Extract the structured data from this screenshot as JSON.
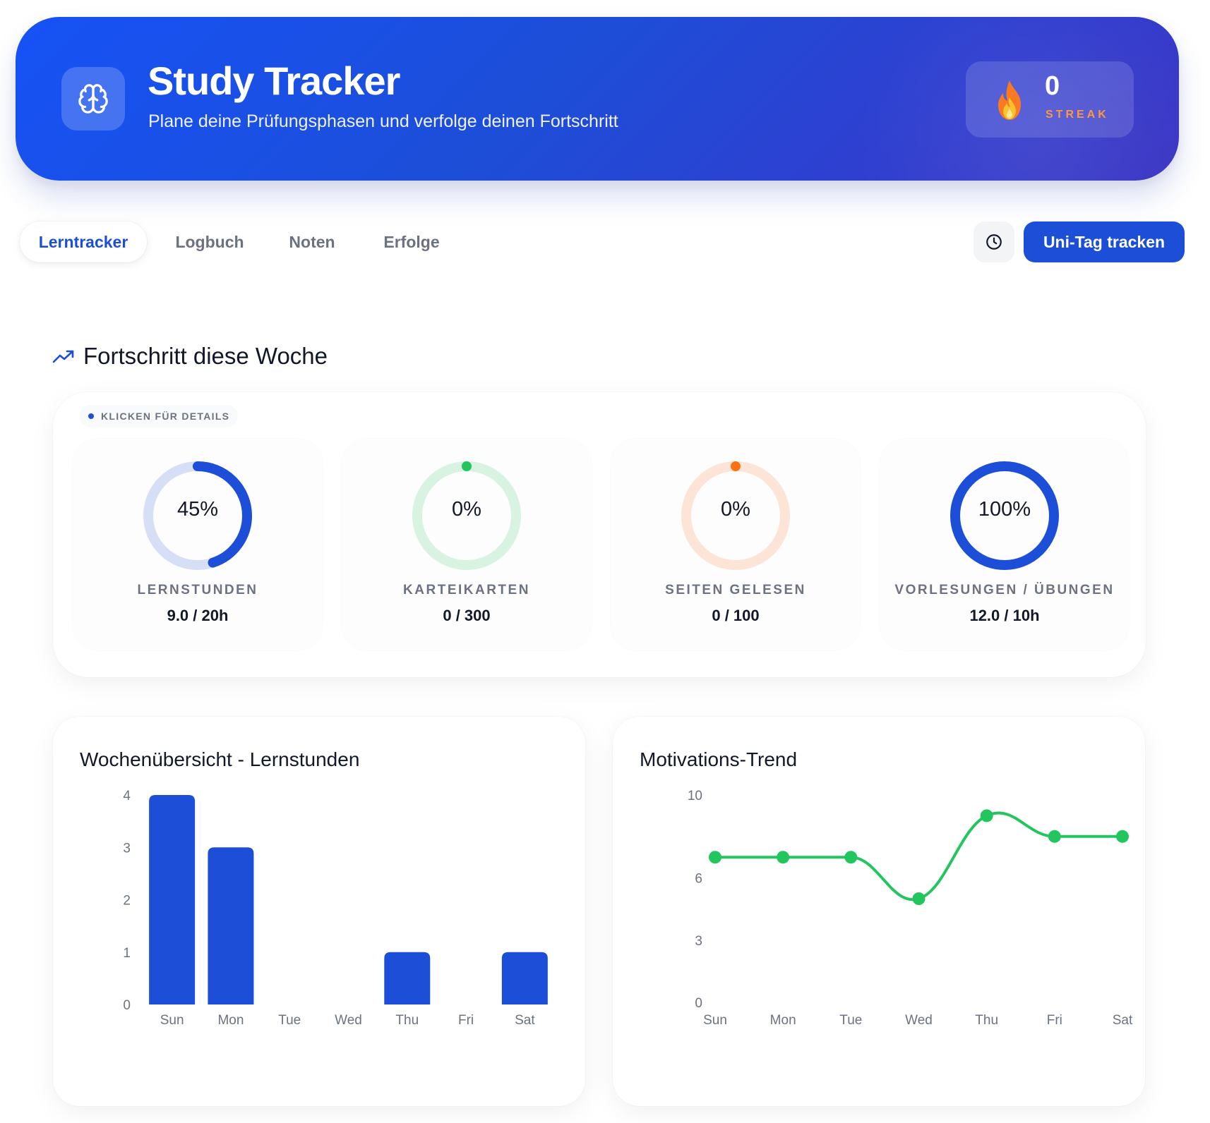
{
  "header": {
    "title": "Study Tracker",
    "subtitle": "Plane deine Prüfungsphasen und verfolge deinen Fortschritt",
    "logo_icon": "brain-icon",
    "streak": {
      "count": "0",
      "label": "STREAK",
      "icon": "fire-icon"
    }
  },
  "nav": {
    "tabs": [
      {
        "label": "Lerntracker",
        "active": true
      },
      {
        "label": "Logbuch",
        "active": false
      },
      {
        "label": "Noten",
        "active": false
      },
      {
        "label": "Erfolge",
        "active": false
      }
    ],
    "history_icon": "clock-icon",
    "track_button": "Uni-Tag tracken"
  },
  "progress": {
    "title": "Fortschritt diese Woche",
    "title_icon": "trending-up-icon",
    "hint": "KLICKEN FÜR DETAILS",
    "metrics": [
      {
        "percent": "45%",
        "fraction": 0.45,
        "label": "LERNSTUNDEN",
        "value": "9.0 / 20h",
        "color": "#1d4ed8"
      },
      {
        "percent": "0%",
        "fraction": 0,
        "label": "KARTEIKARTEN",
        "value": "0 / 300",
        "color": "#22c55e"
      },
      {
        "percent": "0%",
        "fraction": 0,
        "label": "SEITEN GELESEN",
        "value": "0 / 100",
        "color": "#f97316"
      },
      {
        "percent": "100%",
        "fraction": 1,
        "label": "VORLESUNGEN / ÜBUNGEN",
        "value": "12.0 / 10h",
        "color": "#1d4ed8"
      }
    ]
  },
  "charts": {
    "weekly": {
      "title": "Wochenübersicht - Lernstunden"
    },
    "motivation": {
      "title": "Motivations-Trend"
    }
  },
  "chart_data": [
    {
      "type": "bar",
      "title": "Wochenübersicht - Lernstunden",
      "categories": [
        "Sun",
        "Mon",
        "Tue",
        "Wed",
        "Thu",
        "Fri",
        "Sat"
      ],
      "values": [
        4,
        3,
        0,
        0,
        1,
        0,
        1
      ],
      "yticks": [
        "0",
        "1",
        "2",
        "3",
        "4"
      ],
      "ylim": [
        0,
        4
      ],
      "grid": false,
      "color": "#1d4ed8"
    },
    {
      "type": "line",
      "title": "Motivations-Trend",
      "categories": [
        "Sun",
        "Mon",
        "Tue",
        "Wed",
        "Thu",
        "Fri",
        "Sat"
      ],
      "values": [
        7,
        7,
        7,
        5,
        9,
        8,
        8
      ],
      "yticks": [
        "0",
        "3",
        "6",
        "10"
      ],
      "ylim": [
        0,
        10
      ],
      "grid": false,
      "color": "#22c55e"
    }
  ]
}
